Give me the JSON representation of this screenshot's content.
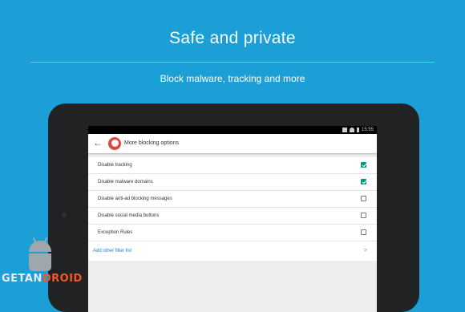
{
  "hero": {
    "title": "Safe and private",
    "subtitle": "Block malware, tracking and more"
  },
  "device": {
    "status_time": "15:55"
  },
  "toolbar": {
    "title": "More blocking options"
  },
  "options": [
    {
      "label": "Disable tracking",
      "checked": true
    },
    {
      "label": "Disable malware domains",
      "checked": true
    },
    {
      "label": "Disable anti-ad blocking messages",
      "checked": false
    },
    {
      "label": "Disable social media buttons",
      "checked": false
    },
    {
      "label": "Exception Rules",
      "checked": false
    }
  ],
  "add_filter": {
    "label": "Add other filter list",
    "chevron": ">"
  },
  "watermark": {
    "part1": "GETAN",
    "part2": "DROID"
  },
  "colors": {
    "background": "#1c9ed6",
    "accent_checkbox": "#009688",
    "link": "#1e88c8"
  }
}
